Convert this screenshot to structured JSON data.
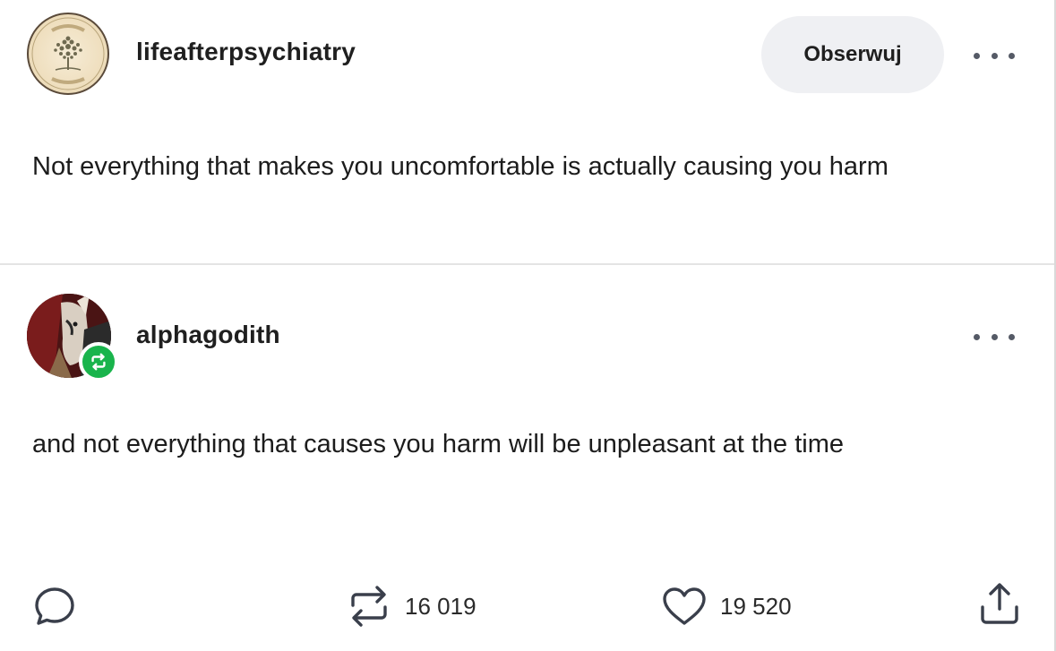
{
  "post": {
    "author": "lifeafterpsychiatry",
    "follow_label": "Obserwuj",
    "text": "Not everything that makes you uncomfortable is actually causing you harm"
  },
  "reblog": {
    "author": "alphagodith",
    "text": "and not everything that causes you harm will be unpleasant at the time"
  },
  "footer": {
    "reblogs_count": "16 019",
    "likes_count": "19 520"
  },
  "icons": {
    "reply": "speech-bubble-icon",
    "reblog": "reblog-arrows-icon",
    "like": "heart-icon",
    "share": "share-upload-icon",
    "more": "ellipsis-icon",
    "reblog_badge": "reblog-badge-icon"
  },
  "colors": {
    "reblog_badge": "#19b44c",
    "follow_button_bg": "#eff0f3",
    "text": "#1c1c1c",
    "icon": "#3a3f4b"
  }
}
